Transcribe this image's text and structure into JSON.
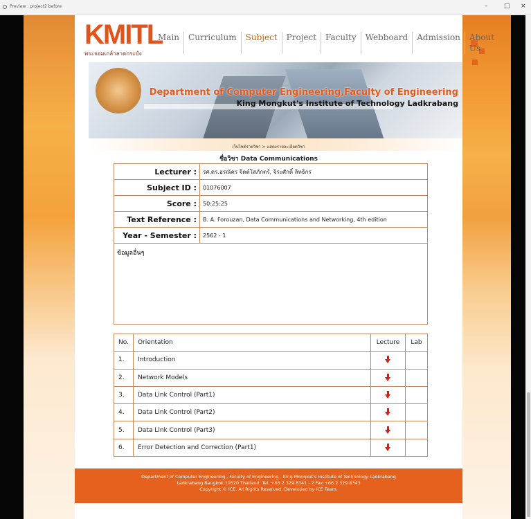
{
  "window": {
    "title": "Preview : project2 before",
    "minimize": "–",
    "maximize": "□",
    "close": "×"
  },
  "logo": {
    "main": "KMITL",
    "sub": "พระจอมเกล้าลาดกระบัง"
  },
  "nav": {
    "items": [
      {
        "label": "Main",
        "active": false
      },
      {
        "label": "Curriculum",
        "active": false
      },
      {
        "label": "Subject",
        "active": true
      },
      {
        "label": "Project",
        "active": false
      },
      {
        "label": "Faculty",
        "active": false
      },
      {
        "label": "Webboard",
        "active": false
      },
      {
        "label": "Admission",
        "active": false
      },
      {
        "label": "About Us",
        "active": false
      }
    ]
  },
  "banner": {
    "title": "Department of Computer Engineering,Faculty of Engineering",
    "subtitle": "King Mongkut's Institute of Technology Ladkrabang"
  },
  "breadcrumb": "เว็บไซต์รายวิชา > แสดงรายละเอียดวิชา",
  "subject_title": "ชื่อวิชา Data Communications",
  "info": {
    "lecturer_label": "Lecturer :",
    "lecturer_value": "รศ.ดร.อรณัคร จิตต์โสภักตร์, จิระศักดิ์ ลิทธิกร",
    "subject_id_label": "Subject ID :",
    "subject_id_value": "01076007",
    "score_label": "Score :",
    "score_value": "50:25:25",
    "text_ref_label": "Text Reference :",
    "text_ref_value": "B. A. Forouzan, Data Communications and Networking, 4th edition",
    "year_label": "Year - Semester :",
    "year_value": "2562 - 1",
    "other_info": "ข้อมูลอื่นๆ"
  },
  "orientation": {
    "headers": {
      "no": "No.",
      "orientation": "Orientation",
      "lecture": "Lecture",
      "lab": "Lab"
    },
    "rows": [
      {
        "no": "1.",
        "title": "Introduction"
      },
      {
        "no": "2.",
        "title": "Network Models"
      },
      {
        "no": "3.",
        "title": "Data Link Control (Part1)"
      },
      {
        "no": "4.",
        "title": "Data Link Control (Part2)"
      },
      {
        "no": "5.",
        "title": "Data Link Control (Part3)"
      },
      {
        "no": "6.",
        "title": "Error Detection and Correction (Part1)"
      }
    ]
  },
  "footer": {
    "line1": "Department of Computer Engineering , Faculty of Engineering , King Mongkut's Institute of Technology Ladkrabang",
    "line2": "Ladkrabang Bangkok 10520 Thailand. Tel. +66 2 329 8341 - 2 Fax +66 2 329 8343",
    "line3": "Copyright © ICE. All Rights Reserved. Developed by ICE Team."
  },
  "colors": {
    "accent": "#e5611e",
    "table_border": "#c08a5c",
    "download": "#d2201a",
    "nav_active": "#b5651d"
  }
}
